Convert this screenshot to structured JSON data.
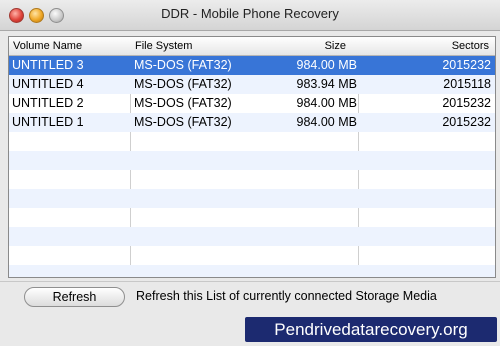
{
  "window": {
    "title": "DDR - Mobile Phone Recovery"
  },
  "table": {
    "headers": {
      "volume_name": "Volume Name",
      "file_system": "File System",
      "size": "Size",
      "sectors": "Sectors"
    },
    "rows": [
      {
        "volume_name": "UNTITLED 3",
        "file_system": "MS-DOS (FAT32)",
        "size": "984.00  MB",
        "sectors": "2015232",
        "selected": true
      },
      {
        "volume_name": "UNTITLED 4",
        "file_system": "MS-DOS (FAT32)",
        "size": "983.94  MB",
        "sectors": "2015118",
        "selected": false
      },
      {
        "volume_name": "UNTITLED 2",
        "file_system": "MS-DOS (FAT32)",
        "size": "984.00  MB",
        "sectors": "2015232",
        "selected": false
      },
      {
        "volume_name": "UNTITLED 1",
        "file_system": "MS-DOS (FAT32)",
        "size": "984.00  MB",
        "sectors": "2015232",
        "selected": false
      }
    ],
    "selection_color": "#3875d7",
    "alt_row_color": "#edf3fe"
  },
  "footer": {
    "refresh_label": "Refresh",
    "refresh_description": "Refresh this List of currently connected Storage Media"
  },
  "watermark": {
    "text": "Pendrivedatarecovery.org"
  }
}
